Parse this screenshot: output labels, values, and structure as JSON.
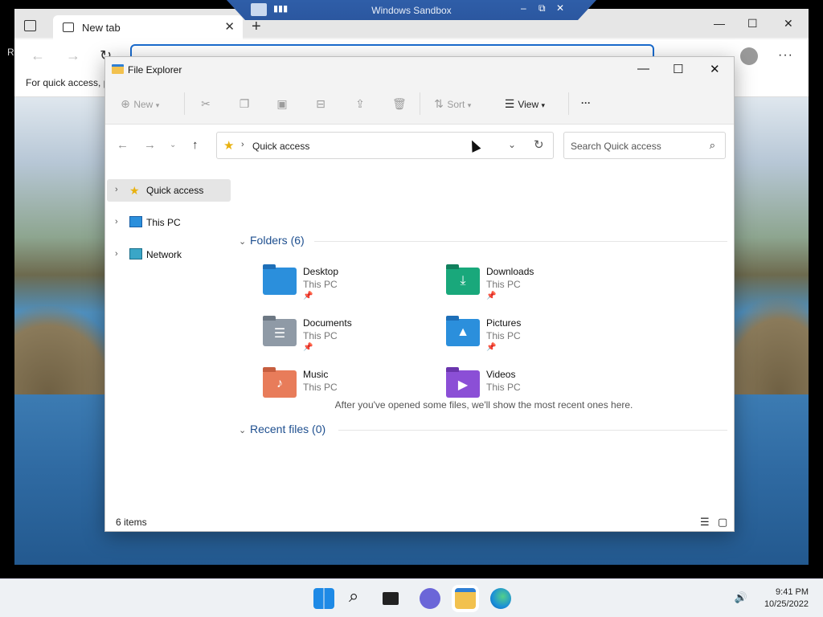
{
  "sandbox": {
    "title": "Windows Sandbox",
    "controls": [
      "–",
      "⧉",
      "✕"
    ]
  },
  "browser": {
    "tab_label": "New tab",
    "tab_close": "✕",
    "new_tab": "+",
    "window_controls": [
      "—",
      "☐",
      "✕"
    ],
    "fav_bar_text": "For quick access, p",
    "left_edge_text": "R",
    "menu": "···"
  },
  "explorer": {
    "title": "File Explorer",
    "window_controls": [
      "—",
      "☐",
      "✕"
    ],
    "toolbar": {
      "new_label": "New",
      "sort_label": "Sort",
      "view_label": "View",
      "more_label": "···"
    },
    "address": {
      "crumb": "Quick access"
    },
    "search": {
      "placeholder": "Search Quick access"
    },
    "sidebar": [
      {
        "label": "Quick access",
        "icon": "star-icon",
        "selected": true
      },
      {
        "label": "This PC",
        "icon": "monitor-icon",
        "selected": false
      },
      {
        "label": "Network",
        "icon": "network-icon",
        "selected": false
      }
    ],
    "folders_header": "Folders (6)",
    "folders": [
      {
        "name": "Desktop",
        "location": "This PC",
        "pinned": true,
        "color": "#2b8fdc"
      },
      {
        "name": "Downloads",
        "location": "This PC",
        "pinned": true,
        "color": "#19a87b"
      },
      {
        "name": "Documents",
        "location": "This PC",
        "pinned": true,
        "color": "#8f9aa6"
      },
      {
        "name": "Pictures",
        "location": "This PC",
        "pinned": true,
        "color": "#2b8fdc"
      },
      {
        "name": "Music",
        "location": "This PC",
        "pinned": false,
        "color": "#e87c5a"
      },
      {
        "name": "Videos",
        "location": "This PC",
        "pinned": false,
        "color": "#8b4fd6"
      }
    ],
    "recent_header": "Recent files (0)",
    "recent_message": "After you've opened some files, we'll show the most recent ones here.",
    "status_count": "6 items"
  },
  "taskbar": {
    "time": "9:41 PM",
    "date": "10/25/2022",
    "apps": [
      "start-icon",
      "search-icon",
      "task-view-icon",
      "chat-icon",
      "file-explorer-icon",
      "edge-icon"
    ]
  }
}
